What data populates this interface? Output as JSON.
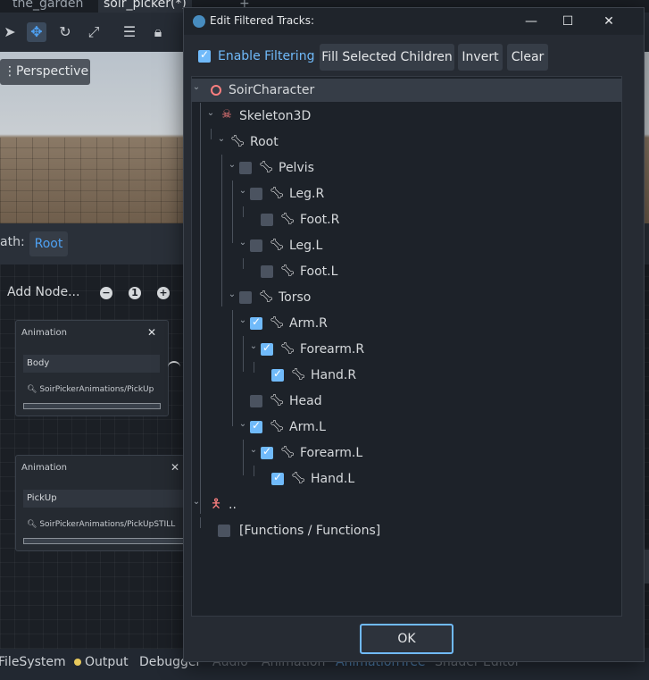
{
  "editor": {
    "tabs": [
      "the_garden",
      "soir_picker(*)"
    ],
    "new_tab_label": "+",
    "perspective_label": "Perspective",
    "path_label": "ath:",
    "path_value": "Root",
    "add_node_label": "Add Node...",
    "zoom_reset_label": "1",
    "nodes": [
      {
        "title": "Animation",
        "field": "Body",
        "path": "SoirPickerAnimations/PickUp"
      },
      {
        "title": "Animation",
        "field": "PickUp",
        "path": "SoirPickerAnimations/PickUpSTILL"
      }
    ],
    "bottom_tabs": [
      "FileSystem",
      "Output",
      "Debugger",
      "Audio",
      "Animation",
      "AnimationTree",
      "Shader Editor"
    ]
  },
  "dialog": {
    "title": "Edit Filtered Tracks:",
    "enable_filtering_label": "Enable Filtering",
    "enable_filtering_checked": true,
    "buttons": {
      "fill_selected_children": "Fill Selected Children",
      "invert": "Invert",
      "clear": "Clear",
      "ok": "OK"
    },
    "tree": [
      {
        "label": "SoirCharacter",
        "icon": "character-ring-icon",
        "checkbox": null
      },
      {
        "label": "Skeleton3D",
        "icon": "skeleton-icon",
        "checkbox": null
      },
      {
        "label": "Root",
        "icon": "bone-icon",
        "checkbox": null
      },
      {
        "label": "Pelvis",
        "icon": "bone-icon",
        "checkbox": false
      },
      {
        "label": "Leg.R",
        "icon": "bone-icon",
        "checkbox": false
      },
      {
        "label": "Foot.R",
        "icon": "bone-icon",
        "checkbox": false
      },
      {
        "label": "Leg.L",
        "icon": "bone-icon",
        "checkbox": false
      },
      {
        "label": "Foot.L",
        "icon": "bone-icon",
        "checkbox": false
      },
      {
        "label": "Torso",
        "icon": "bone-icon",
        "checkbox": false
      },
      {
        "label": "Arm.R",
        "icon": "bone-icon",
        "checkbox": true
      },
      {
        "label": "Forearm.R",
        "icon": "bone-icon",
        "checkbox": true
      },
      {
        "label": "Hand.R",
        "icon": "bone-icon",
        "checkbox": true
      },
      {
        "label": "Head",
        "icon": "bone-icon",
        "checkbox": false
      },
      {
        "label": "Arm.L",
        "icon": "bone-icon",
        "checkbox": true
      },
      {
        "label": "Forearm.L",
        "icon": "bone-icon",
        "checkbox": true
      },
      {
        "label": "Hand.L",
        "icon": "bone-icon",
        "checkbox": true
      },
      {
        "label": "..",
        "icon": "person-icon",
        "checkbox": null
      },
      {
        "label": "[Functions / Functions]",
        "icon": "",
        "checkbox": false
      }
    ],
    "accent_color": "#70bafa"
  }
}
